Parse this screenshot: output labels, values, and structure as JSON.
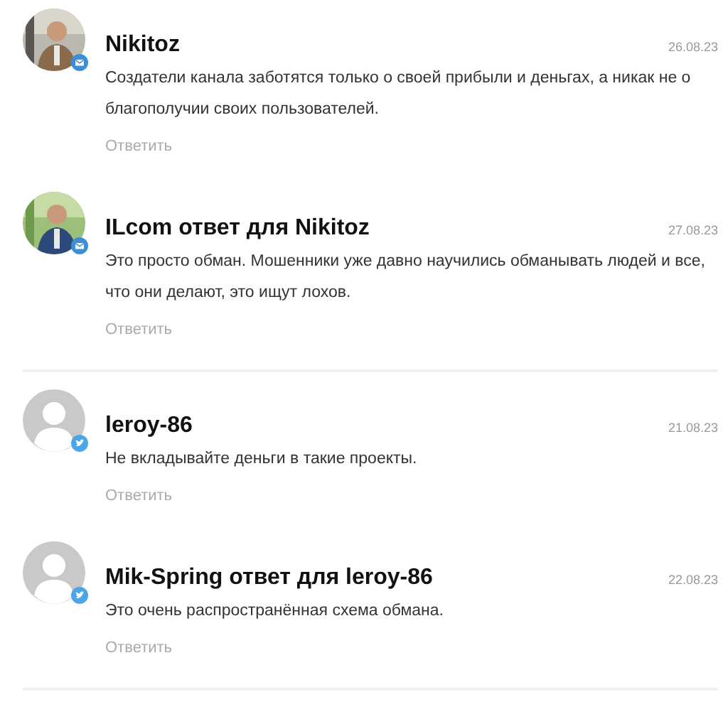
{
  "threads": [
    {
      "comments": [
        {
          "heading": "Nikitoz",
          "date": "26.08.23",
          "text": "Создатели канала заботятся только о своей прибыли и деньгах, а никак не о благополучии своих пользователей.",
          "reply": "Ответить"
        },
        {
          "heading": "ILcom ответ для Nikitoz",
          "date": "27.08.23",
          "text": "Это просто обман. Мошенники уже давно научились обманывать людей и все, что они делают, это ищут лохов.",
          "reply": "Ответить"
        }
      ]
    },
    {
      "comments": [
        {
          "kind": "blank",
          "heading": "leroy-86",
          "date": "21.08.23",
          "text": "Не вкладывайте деньги в такие проекты.",
          "reply": "Ответить"
        },
        {
          "kind": "blank",
          "heading": "Mik-Spring ответ для leroy-86",
          "date": "22.08.23",
          "text": "Это очень распространённая схема обмана.",
          "reply": "Ответить"
        }
      ]
    }
  ]
}
